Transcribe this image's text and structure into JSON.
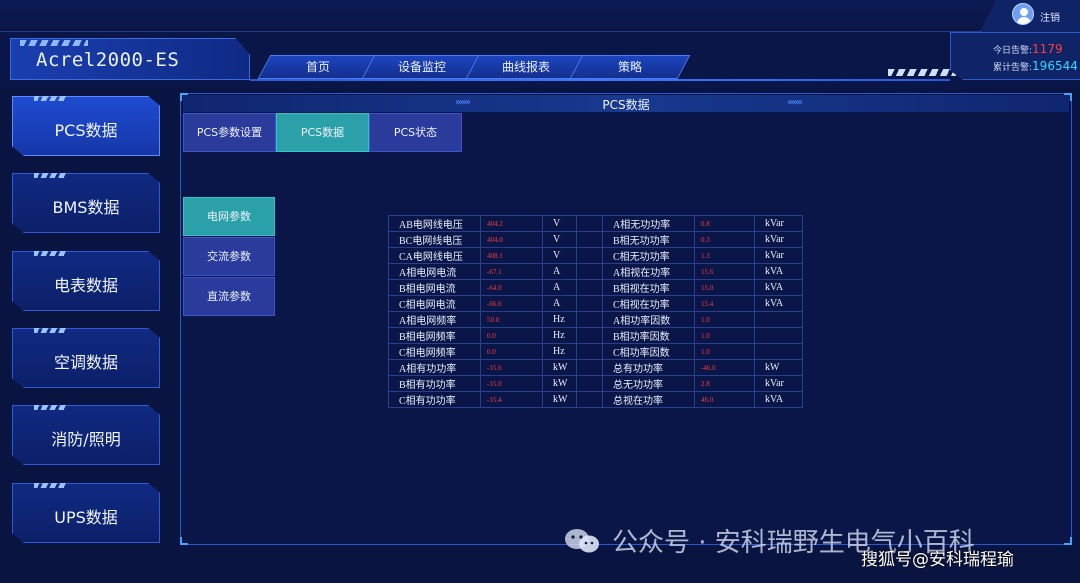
{
  "topbar": {
    "logout_label": "注销"
  },
  "header": {
    "logo": "Acrel2000-ES",
    "nav": [
      "首页",
      "设备监控",
      "曲线报表",
      "策略"
    ],
    "alarms": [
      {
        "label": "今日告警:",
        "value": "1179",
        "color": "#ff3b3b"
      },
      {
        "label": "累计告警:",
        "value": "196544",
        "color": "#2fd8ff"
      }
    ]
  },
  "sidebar": {
    "items": [
      {
        "label": "PCS数据",
        "active": true
      },
      {
        "label": "BMS数据",
        "active": false
      },
      {
        "label": "电表数据",
        "active": false
      },
      {
        "label": "空调数据",
        "active": false
      },
      {
        "label": "消防/照明",
        "active": false
      },
      {
        "label": "UPS数据",
        "active": false
      }
    ]
  },
  "panel": {
    "title": "PCS数据",
    "tabs": [
      {
        "label": "PCS参数设置",
        "active": false
      },
      {
        "label": "PCS数据",
        "active": true
      },
      {
        "label": "PCS状态",
        "active": false
      }
    ],
    "param_buttons": [
      {
        "label": "电网参数",
        "active": true
      },
      {
        "label": "交流参数",
        "active": false
      },
      {
        "label": "直流参数",
        "active": false
      }
    ],
    "table": [
      [
        "AB电网线电压",
        "404.2",
        "V",
        "",
        "A相无功功率",
        "0.8",
        "kVar"
      ],
      [
        "BC电网线电压",
        "404.0",
        "V",
        "",
        "B相无功功率",
        "0.3",
        "kVar"
      ],
      [
        "CA电网线电压",
        "408.1",
        "V",
        "",
        "C相无功功率",
        "1.3",
        "kVar"
      ],
      [
        "A相电网电流",
        "-67.1",
        "A",
        "",
        "A相视在功率",
        "15.6",
        "kVA"
      ],
      [
        "B相电网电流",
        "-64.0",
        "A",
        "",
        "B相视在功率",
        "15.0",
        "kVA"
      ],
      [
        "C相电网电流",
        "-66.6",
        "A",
        "",
        "C相视在功率",
        "15.4",
        "kVA"
      ],
      [
        "A相电网频率",
        "50.0",
        "Hz",
        "",
        "A相功率因数",
        "1.0",
        ""
      ],
      [
        "B相电网频率",
        "0.0",
        "Hz",
        "",
        "B相功率因数",
        "1.0",
        ""
      ],
      [
        "C相电网频率",
        "0.0",
        "Hz",
        "",
        "C相功率因数",
        "1.0",
        ""
      ],
      [
        "A相有功功率",
        "-15.6",
        "kW",
        "",
        "总有功功率",
        "-46.0",
        "kW"
      ],
      [
        "B相有功功率",
        "-15.0",
        "kW",
        "",
        "总无功功率",
        "2.8",
        "kVar"
      ],
      [
        "C相有功功率",
        "-15.4",
        "kW",
        "",
        "总视在功率",
        "46.0",
        "kVA"
      ]
    ]
  },
  "watermarks": {
    "wechat": "公众号 · 安科瑞野生电气小百科",
    "sohu": "搜狐号@安科瑞程瑜"
  }
}
